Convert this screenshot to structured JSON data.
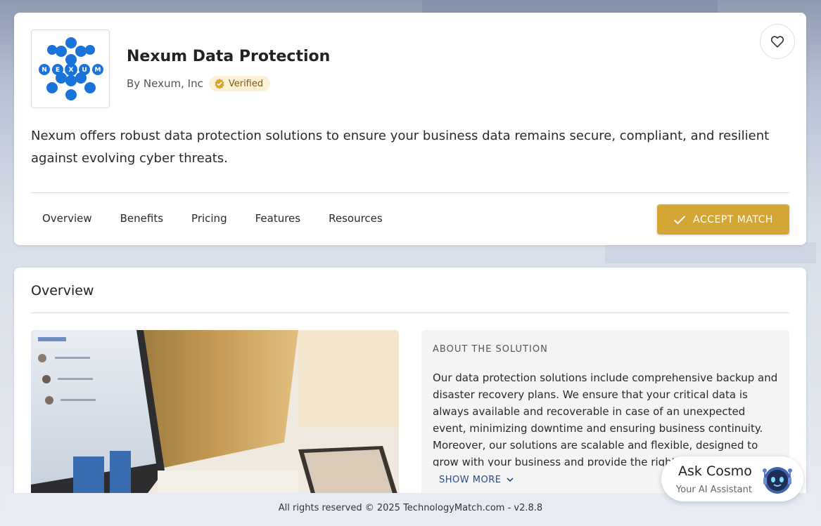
{
  "product": {
    "name": "Nexum Data Protection",
    "by": "By Nexum, Inc",
    "verified_label": "Verified",
    "description": "Nexum offers robust data protection solutions to ensure your business data remains secure, compliant, and resilient against evolving cyber threats.",
    "logo_letters": [
      "N",
      "E",
      "X",
      "U",
      "M"
    ],
    "logo_color": "#1a73d9"
  },
  "tabs": [
    {
      "label": "Overview"
    },
    {
      "label": "Benefits"
    },
    {
      "label": "Pricing"
    },
    {
      "label": "Features"
    },
    {
      "label": "Resources"
    }
  ],
  "actions": {
    "accept_match": "ACCEPT MATCH",
    "accent_color": "#d4a636"
  },
  "overview": {
    "title": "Overview",
    "about_label": "ABOUT THE SOLUTION",
    "about_text": "Our data protection solutions include comprehensive backup and disaster recovery plans. We ensure that your critical data is always available and recoverable in case of an unexpected event, minimizing downtime and ensuring business continuity. Moreover, our solutions are scalable and flexible, designed to grow with your business and provide the right",
    "show_more": "SHOW MORE"
  },
  "assistant": {
    "title": "Ask Cosmo",
    "subtitle": "Your AI Assistant"
  },
  "footer": {
    "text": "All rights reserved © 2025 TechnologyMatch.com - v2.8.8"
  }
}
